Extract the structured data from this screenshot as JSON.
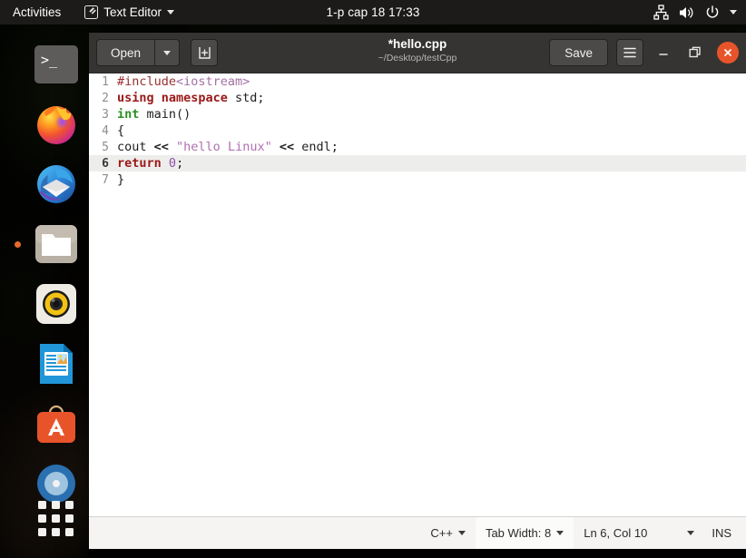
{
  "topbar": {
    "activities": "Activities",
    "app_name": "Text Editor",
    "app_icon": "text-editor-icon",
    "clock": "1-p cap 18  17:33",
    "sys_icons": [
      "network-wired-icon",
      "volume-icon",
      "power-icon",
      "chevron-down-icon"
    ]
  },
  "dock": {
    "items": [
      {
        "name": "terminal",
        "label": "Terminal",
        "running": false
      },
      {
        "name": "firefox",
        "label": "Firefox",
        "running": false
      },
      {
        "name": "thunderbird",
        "label": "Thunderbird Mail",
        "running": false
      },
      {
        "name": "files",
        "label": "Files",
        "running": true
      },
      {
        "name": "rhythmbox",
        "label": "Rhythmbox",
        "running": false
      },
      {
        "name": "libreoffice-writer",
        "label": "LibreOffice Writer",
        "running": false
      },
      {
        "name": "ubuntu-software",
        "label": "Ubuntu Software",
        "running": false
      },
      {
        "name": "help",
        "label": "Help",
        "running": false
      }
    ],
    "app_grid_label": "Show Applications"
  },
  "window": {
    "open_label": "Open",
    "open_dropdown_icon": "chevron-down-icon",
    "new_tab_icon": "new-document-icon",
    "title": "*hello.cpp",
    "path": "~/Desktop/testCpp",
    "save_label": "Save",
    "menu_icon": "hamburger-menu-icon",
    "minimize_icon": "minimize-icon",
    "restore_icon": "restore-icon",
    "close_icon": "close-icon"
  },
  "editor": {
    "current_line": 6,
    "lines": [
      {
        "n": "1",
        "tokens": [
          {
            "t": "#include",
            "c": "tok-pre"
          },
          {
            "t": "<iostream>",
            "c": "tok-hdr"
          }
        ]
      },
      {
        "n": "2",
        "tokens": [
          {
            "t": "using namespace",
            "c": "tok-kw"
          },
          {
            "t": " std;",
            "c": "tok-plain"
          }
        ]
      },
      {
        "n": "3",
        "tokens": [
          {
            "t": "int",
            "c": "tok-type"
          },
          {
            "t": " main()",
            "c": "tok-plain"
          }
        ]
      },
      {
        "n": "4",
        "tokens": [
          {
            "t": "{",
            "c": "tok-plain"
          }
        ]
      },
      {
        "n": "5",
        "tokens": [
          {
            "t": "cout ",
            "c": "tok-plain"
          },
          {
            "t": "<<",
            "c": "tok-op"
          },
          {
            "t": " ",
            "c": "tok-plain"
          },
          {
            "t": "\"hello Linux\"",
            "c": "tok-str"
          },
          {
            "t": " ",
            "c": "tok-plain"
          },
          {
            "t": "<<",
            "c": "tok-op"
          },
          {
            "t": " endl;",
            "c": "tok-plain"
          }
        ]
      },
      {
        "n": "6",
        "tokens": [
          {
            "t": "return",
            "c": "tok-kw"
          },
          {
            "t": " ",
            "c": "tok-plain"
          },
          {
            "t": "0",
            "c": "tok-num"
          },
          {
            "t": ";",
            "c": "tok-plain"
          }
        ]
      },
      {
        "n": "7",
        "tokens": [
          {
            "t": "}",
            "c": "tok-plain"
          }
        ]
      }
    ]
  },
  "statusbar": {
    "language": "C++",
    "tab_width": "Tab Width: 8",
    "cursor_position": "Ln 6, Col 10",
    "insert_mode": "INS"
  },
  "colors": {
    "accent_orange": "#e8542a",
    "headerbar": "#353433",
    "topbar": "#1d1b19",
    "current_line_highlight": "#ededeb",
    "statusbar_bg": "#f5f4f2"
  }
}
